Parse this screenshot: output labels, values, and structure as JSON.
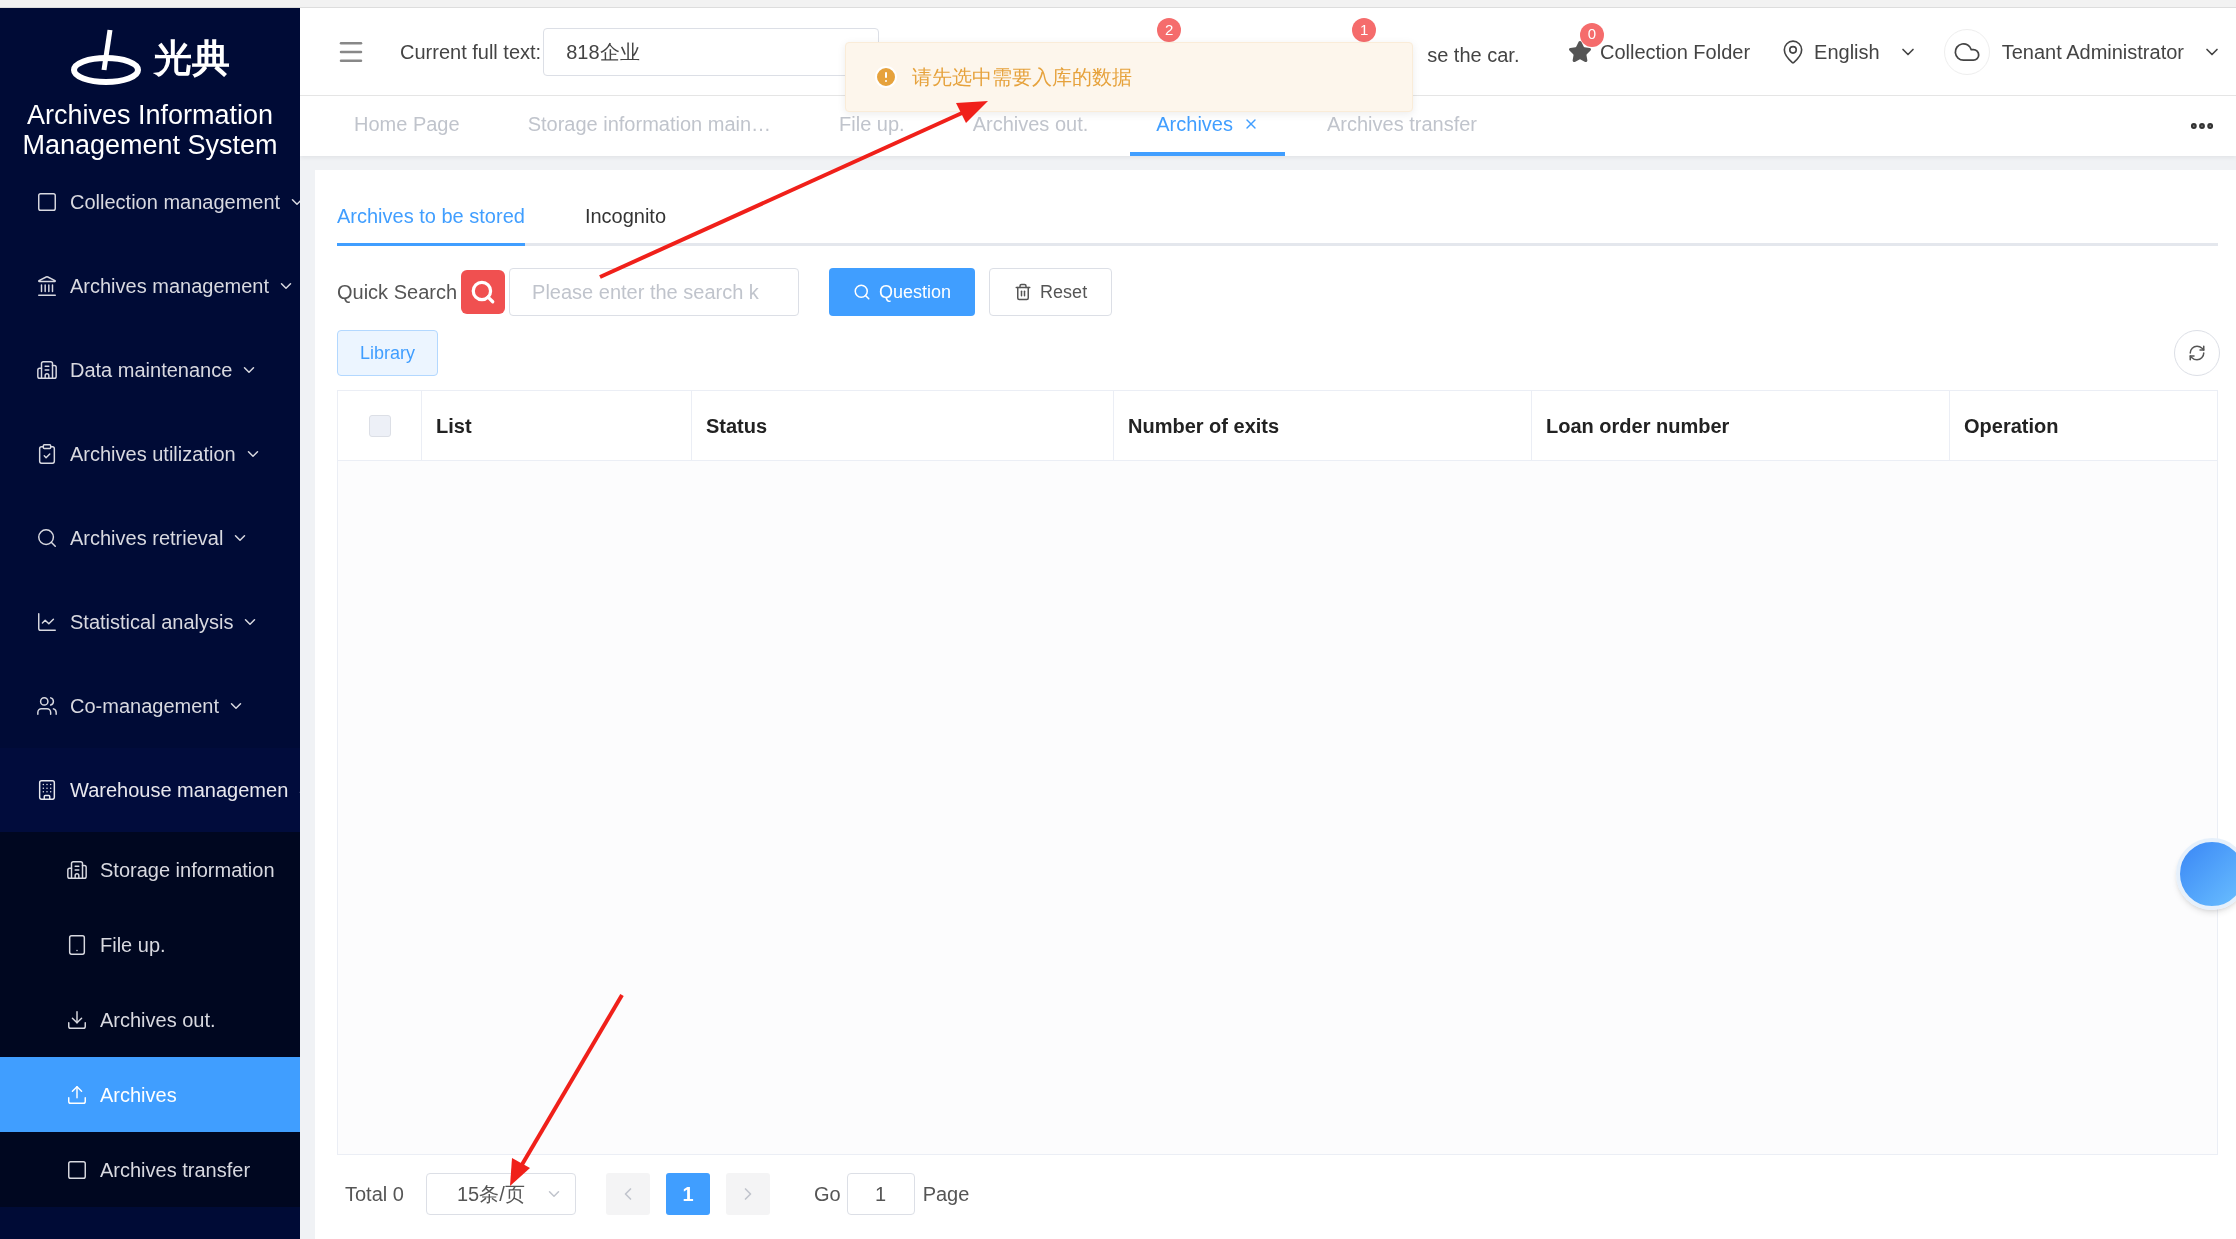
{
  "sidebar": {
    "logo_text": "光典",
    "title": "Archives Information Management System",
    "items": [
      {
        "label": "Collection management",
        "expanded": false
      },
      {
        "label": "Archives management",
        "expanded": false
      },
      {
        "label": "Data maintenance",
        "expanded": false
      },
      {
        "label": "Archives utilization",
        "expanded": false
      },
      {
        "label": "Archives retrieval",
        "expanded": false
      },
      {
        "label": "Statistical analysis",
        "expanded": false
      },
      {
        "label": "Co-management",
        "expanded": false
      },
      {
        "label": "Warehouse managemen",
        "expanded": true,
        "children": [
          {
            "label": "Storage information",
            "selected": false
          },
          {
            "label": "File up.",
            "selected": false
          },
          {
            "label": "Archives out.",
            "selected": false
          },
          {
            "label": "Archives",
            "selected": true
          },
          {
            "label": "Archives transfer",
            "selected": false
          }
        ]
      }
    ]
  },
  "header": {
    "search_label": "Current full text:",
    "search_value": "818企业",
    "badges": [
      "2",
      "1"
    ],
    "partial_item": "se the car.",
    "favorites": {
      "badge": "0",
      "label": "Collection Folder"
    },
    "language": "English",
    "user": "Tenant Administrator"
  },
  "toast": {
    "message": "请先选中需要入库的数据"
  },
  "page_tabs": [
    {
      "label": "Home Page",
      "selected": false,
      "closable": false
    },
    {
      "label": "Storage information main…",
      "selected": false,
      "closable": false
    },
    {
      "label": "File up.",
      "selected": false,
      "closable": false
    },
    {
      "label": "Archives out.",
      "selected": false,
      "closable": false
    },
    {
      "label": "Archives",
      "selected": true,
      "closable": true
    },
    {
      "label": "Archives transfer",
      "selected": false,
      "closable": false
    }
  ],
  "sub_tabs": [
    {
      "label": "Archives to be stored",
      "selected": true
    },
    {
      "label": "Incognito",
      "selected": false
    }
  ],
  "search": {
    "label": "Quick Search",
    "placeholder": "Please enter the search k",
    "buttons": [
      "Question",
      "Reset"
    ]
  },
  "library_button": "Library",
  "table": {
    "select_all_checked": false,
    "columns": [
      "List",
      "Status",
      "Number of exits",
      "Loan order number",
      "Operation"
    ]
  },
  "pagination": {
    "total": "Total 0",
    "page_size": "15条/页",
    "pages": [
      {
        "label": "1",
        "selected": true
      }
    ],
    "go_label": "Go",
    "go_value": "1",
    "page_label": "Page"
  }
}
